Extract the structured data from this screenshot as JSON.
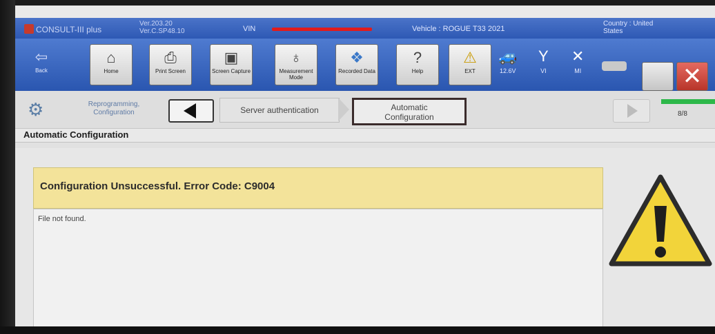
{
  "title_bar": {
    "app_name": "CONSULT-III plus",
    "version_line1": "Ver.203.20",
    "version_line2": "Ver.C.SP48.10",
    "vin_label": "VIN",
    "vehicle": "Vehicle : ROGUE T33 2021",
    "country_line1": "Country : United",
    "country_line2": "States"
  },
  "toolbar": {
    "back_label": "Back",
    "home_label": "Home",
    "print_label": "Print Screen",
    "capture_label": "Screen Capture",
    "measurement_label": "Measurement Mode",
    "recorded_label": "Recorded Data",
    "help_label": "Help",
    "ext_label": "EXT",
    "voltage": "12.6V",
    "vi_label": "VI",
    "mi_label": "MI"
  },
  "stepbar": {
    "step_label": "Reprogramming, Configuration",
    "previous_step": "Server authentication",
    "current_step_line1": "Automatic",
    "current_step_line2": "Configuration",
    "progress": "8/8",
    "progress_fraction": 1.0
  },
  "main": {
    "section_title": "Automatic Configuration",
    "error_message": "Configuration Unsuccessful. Error Code: C9004",
    "detail": "File not found."
  },
  "colors": {
    "toolbar_blue": "#2e59b4",
    "banner_yellow": "#f3e39a",
    "warning_yellow": "#f2d43a",
    "close_red": "#c43a2e",
    "progress_green": "#2db84a"
  }
}
